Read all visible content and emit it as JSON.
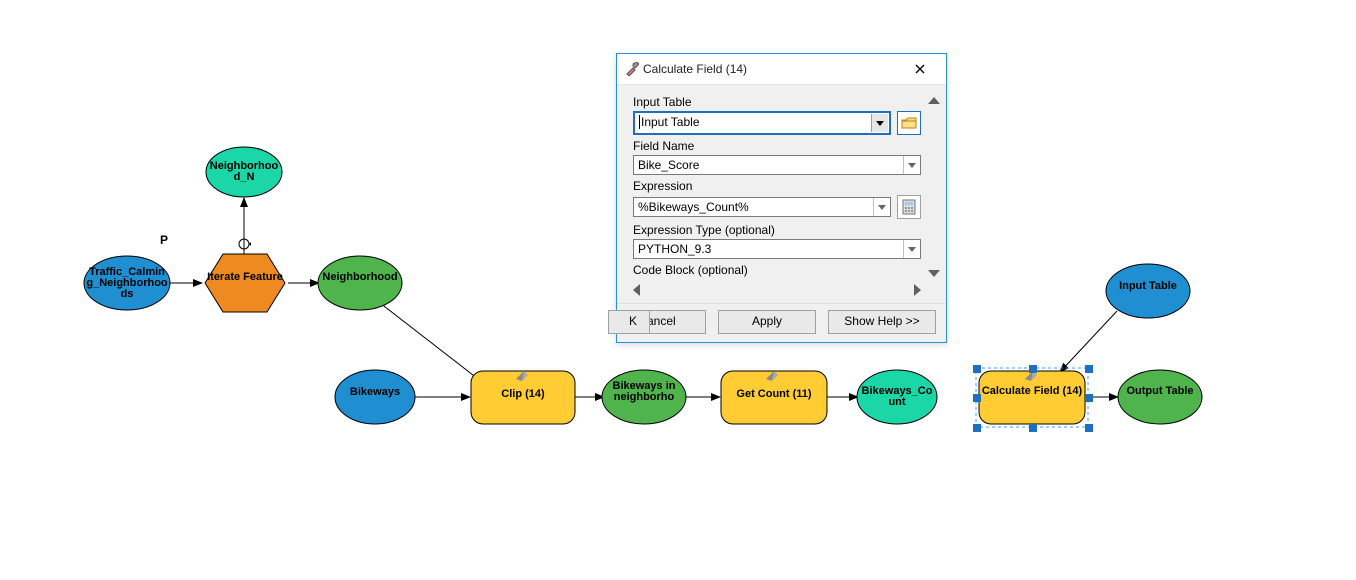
{
  "canvas": {
    "p_marker": "P",
    "nodes": {
      "traffic_calming": "Traffic_Calming_Neighborhoods",
      "neighborhood_n": "Neighborhood_N",
      "iterate_feature": "Iterate Feature",
      "neighborhood": "Neighborhood",
      "bikeways": "Bikeways",
      "clip": "Clip (14)",
      "bikeways_in": "Bikeways in neighborho",
      "get_count": "Get Count (11)",
      "bikeways_count": "Bikeways_Count",
      "calculate_field": "Calculate Field (14)",
      "input_table": "Input Table",
      "output_table": "Output Table"
    }
  },
  "dialog": {
    "title": "Calculate Field (14)",
    "labels": {
      "input_table": "Input Table",
      "field_name": "Field Name",
      "expression": "Expression",
      "expression_type": "Expression Type (optional)",
      "code_block": "Code Block (optional)"
    },
    "values": {
      "input_table": "Input Table",
      "field_name": "Bike_Score",
      "expression": "%Bikeways_Count%",
      "expression_type": "PYTHON_9.3"
    },
    "buttons": {
      "ok_partial": "K",
      "cancel": "Cancel",
      "apply": "Apply",
      "show_help": "Show Help >>"
    }
  }
}
